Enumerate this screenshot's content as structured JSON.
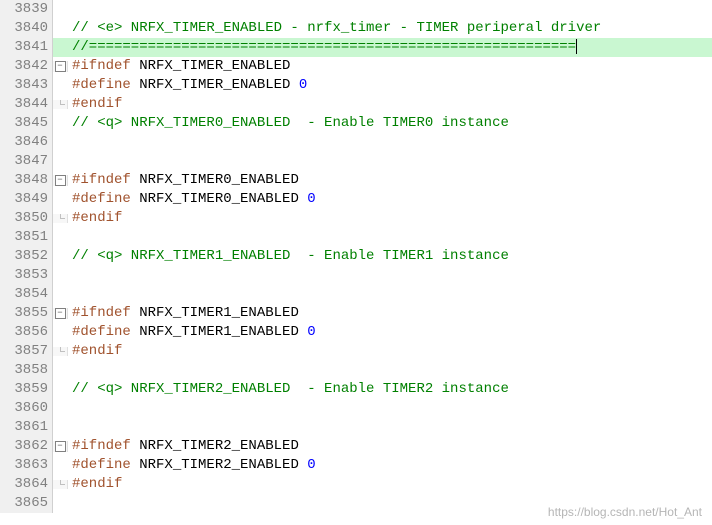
{
  "watermark": "https://blog.csdn.net/Hot_Ant",
  "lines": [
    {
      "num": "3839",
      "fold": "line",
      "hl": false,
      "tokens": [
        {
          "c": "comment",
          "t": " "
        }
      ]
    },
    {
      "num": "3840",
      "fold": "line",
      "hl": false,
      "tokens": [
        {
          "c": "comment",
          "t": "// <e> NRFX_TIMER_ENABLED - nrfx_timer - TIMER periperal driver"
        }
      ]
    },
    {
      "num": "3841",
      "fold": "line",
      "hl": true,
      "tokens": [
        {
          "c": "comment",
          "t": "//=========================================================="
        },
        {
          "c": "cursor",
          "t": ""
        }
      ]
    },
    {
      "num": "3842",
      "fold": "minus",
      "hl": false,
      "tokens": [
        {
          "c": "preproc",
          "t": "#ifndef "
        },
        {
          "c": "ident",
          "t": "NRFX_TIMER_ENABLED"
        }
      ]
    },
    {
      "num": "3843",
      "fold": "line",
      "hl": false,
      "tokens": [
        {
          "c": "preproc",
          "t": "#define "
        },
        {
          "c": "ident",
          "t": "NRFX_TIMER_ENABLED "
        },
        {
          "c": "num",
          "t": "0"
        }
      ]
    },
    {
      "num": "3844",
      "fold": "end",
      "hl": false,
      "tokens": [
        {
          "c": "preproc",
          "t": "#endif"
        }
      ]
    },
    {
      "num": "3845",
      "fold": "line",
      "hl": false,
      "tokens": [
        {
          "c": "comment",
          "t": "// <q> NRFX_TIMER0_ENABLED  - Enable TIMER0 instance"
        }
      ]
    },
    {
      "num": "3846",
      "fold": "line",
      "hl": false,
      "tokens": [
        {
          "c": "comment",
          "t": " "
        }
      ]
    },
    {
      "num": "3847",
      "fold": "line",
      "hl": false,
      "tokens": [
        {
          "c": "comment",
          "t": ""
        }
      ]
    },
    {
      "num": "3848",
      "fold": "minus",
      "hl": false,
      "tokens": [
        {
          "c": "preproc",
          "t": "#ifndef "
        },
        {
          "c": "ident",
          "t": "NRFX_TIMER0_ENABLED"
        }
      ]
    },
    {
      "num": "3849",
      "fold": "line",
      "hl": false,
      "tokens": [
        {
          "c": "preproc",
          "t": "#define "
        },
        {
          "c": "ident",
          "t": "NRFX_TIMER0_ENABLED "
        },
        {
          "c": "num",
          "t": "0"
        }
      ]
    },
    {
      "num": "3850",
      "fold": "end",
      "hl": false,
      "tokens": [
        {
          "c": "preproc",
          "t": "#endif"
        }
      ]
    },
    {
      "num": "3851",
      "fold": "line",
      "hl": false,
      "tokens": [
        {
          "c": "comment",
          "t": ""
        }
      ]
    },
    {
      "num": "3852",
      "fold": "line",
      "hl": false,
      "tokens": [
        {
          "c": "comment",
          "t": "// <q> NRFX_TIMER1_ENABLED  - Enable TIMER1 instance"
        }
      ]
    },
    {
      "num": "3853",
      "fold": "line",
      "hl": false,
      "tokens": [
        {
          "c": "comment",
          "t": " "
        }
      ]
    },
    {
      "num": "3854",
      "fold": "line",
      "hl": false,
      "tokens": [
        {
          "c": "comment",
          "t": ""
        }
      ]
    },
    {
      "num": "3855",
      "fold": "minus",
      "hl": false,
      "tokens": [
        {
          "c": "preproc",
          "t": "#ifndef "
        },
        {
          "c": "ident",
          "t": "NRFX_TIMER1_ENABLED"
        }
      ]
    },
    {
      "num": "3856",
      "fold": "line",
      "hl": false,
      "tokens": [
        {
          "c": "preproc",
          "t": "#define "
        },
        {
          "c": "ident",
          "t": "NRFX_TIMER1_ENABLED "
        },
        {
          "c": "num",
          "t": "0"
        }
      ]
    },
    {
      "num": "3857",
      "fold": "end",
      "hl": false,
      "tokens": [
        {
          "c": "preproc",
          "t": "#endif"
        }
      ]
    },
    {
      "num": "3858",
      "fold": "line",
      "hl": false,
      "tokens": [
        {
          "c": "comment",
          "t": ""
        }
      ]
    },
    {
      "num": "3859",
      "fold": "line",
      "hl": false,
      "tokens": [
        {
          "c": "comment",
          "t": "// <q> NRFX_TIMER2_ENABLED  - Enable TIMER2 instance"
        }
      ]
    },
    {
      "num": "3860",
      "fold": "line",
      "hl": false,
      "tokens": [
        {
          "c": "comment",
          "t": " "
        }
      ]
    },
    {
      "num": "3861",
      "fold": "line",
      "hl": false,
      "tokens": [
        {
          "c": "comment",
          "t": ""
        }
      ]
    },
    {
      "num": "3862",
      "fold": "minus",
      "hl": false,
      "tokens": [
        {
          "c": "preproc",
          "t": "#ifndef "
        },
        {
          "c": "ident",
          "t": "NRFX_TIMER2_ENABLED"
        }
      ]
    },
    {
      "num": "3863",
      "fold": "line",
      "hl": false,
      "tokens": [
        {
          "c": "preproc",
          "t": "#define "
        },
        {
          "c": "ident",
          "t": "NRFX_TIMER2_ENABLED "
        },
        {
          "c": "num",
          "t": "0"
        }
      ]
    },
    {
      "num": "3864",
      "fold": "end",
      "hl": false,
      "tokens": [
        {
          "c": "preproc",
          "t": "#endif"
        }
      ]
    },
    {
      "num": "3865",
      "fold": "line",
      "hl": false,
      "tokens": [
        {
          "c": "comment",
          "t": ""
        }
      ]
    }
  ]
}
